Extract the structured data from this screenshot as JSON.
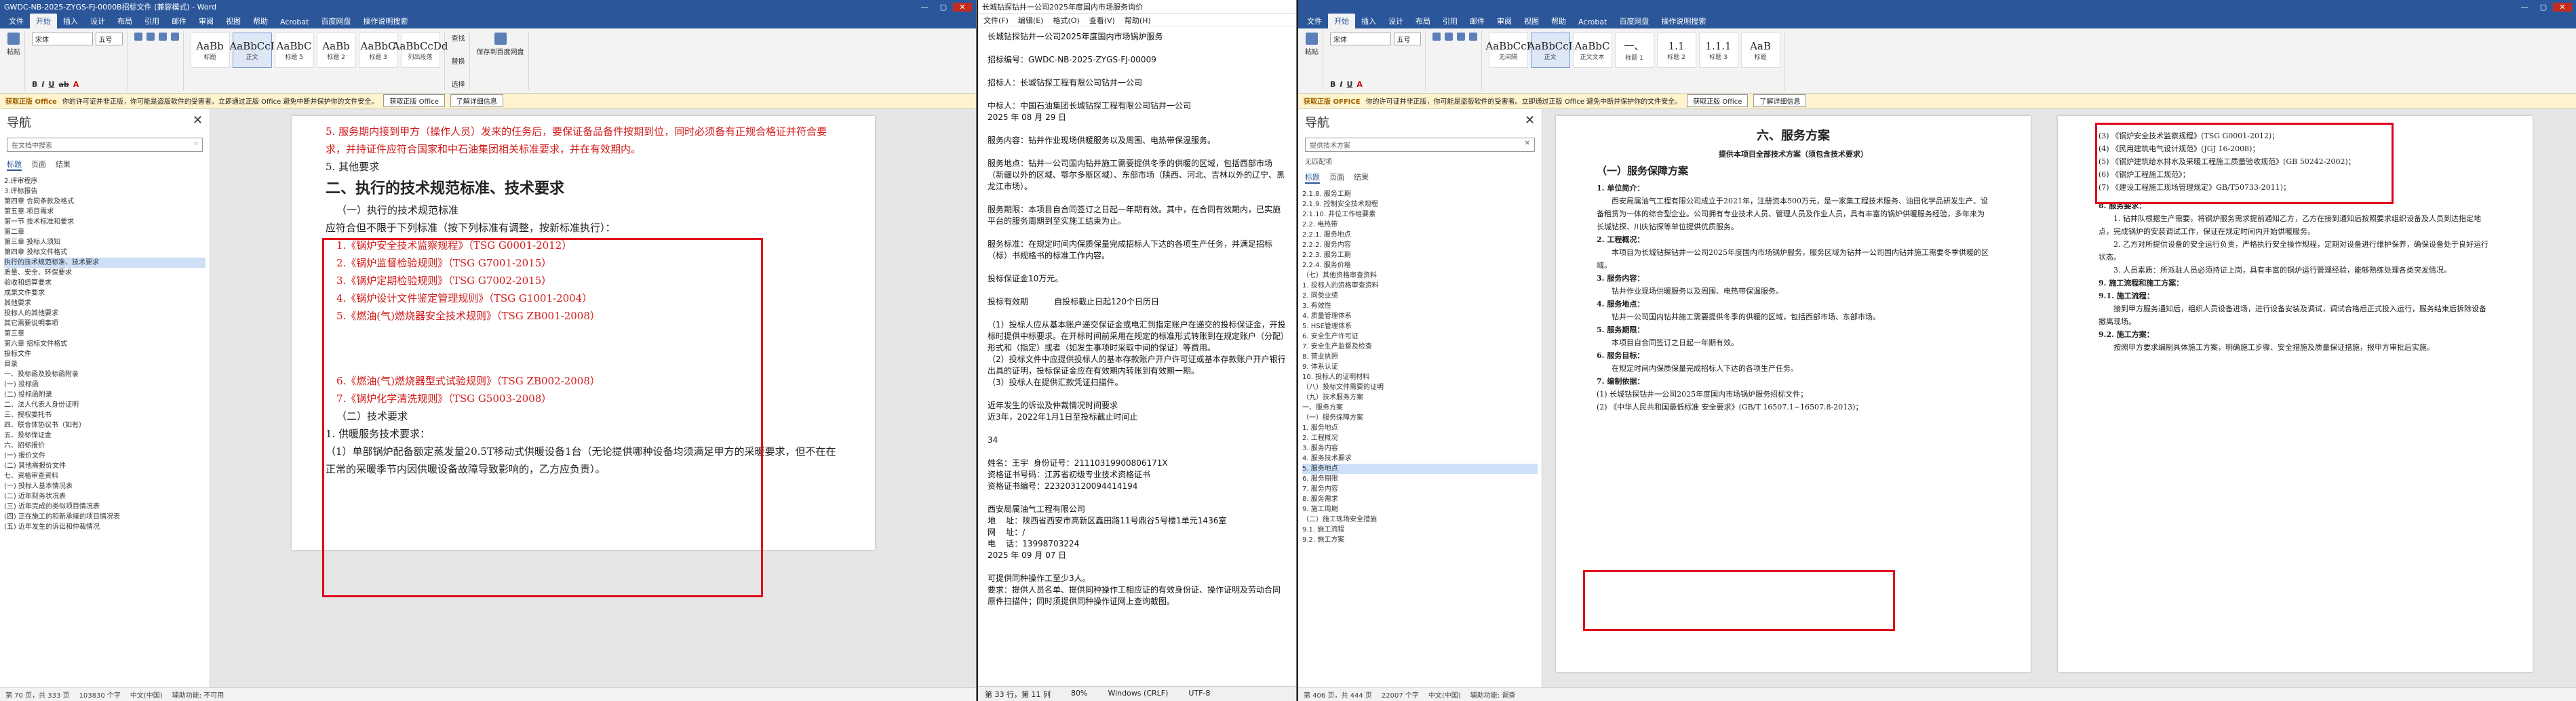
{
  "w1": {
    "title": "GWDC-NB-2025-ZYGS-FJ-0000B招标文件 (兼容模式) - Word",
    "tabs": [
      "文件",
      "开始",
      "插入",
      "设计",
      "布局",
      "引用",
      "邮件",
      "审阅",
      "视图",
      "帮助",
      "Acrobat",
      "百度网盘",
      "操作说明搜索"
    ],
    "font_name": "宋体",
    "font_size": "五号",
    "styles": [
      {
        "preview": "AaBb",
        "name": "标题"
      },
      {
        "preview": "AaBbCcI",
        "name": "正文"
      },
      {
        "preview": "AaBbC",
        "name": "标题 5"
      },
      {
        "preview": "AaBb",
        "name": "标题 2"
      },
      {
        "preview": "AaBbC",
        "name": "标题 3"
      },
      {
        "preview": "AaBbCcDd",
        "name": "列出段落"
      }
    ],
    "ribbon_right": [
      "查找",
      "替换",
      "选择",
      "保存到百度网盘"
    ],
    "infobar": {
      "warn": "获取正版 Office",
      "text": "你的许可证并非正版，你可能是盗版软件的受害者。立即通过正版 Office 避免中断并保护你的文件安全。",
      "btn1": "获取正版 Office",
      "btn2": "了解详细信息"
    },
    "nav": {
      "title": "导航",
      "search": "在文档中搜索",
      "tabs": [
        "标题",
        "页面",
        "结果"
      ],
      "items": [
        "2.评审程序",
        "3.评标报告",
        "第四章  合同条款及格式",
        "第五章  项目需求",
        "第一节  技术标准和要求",
        "第二章",
        "第三章  投标人须知",
        "第四章  投标文件格式",
        "执行的技术规范标准、技术要求",
        "质量、安全、环保要求",
        "验收和结算要求",
        "成果文件要求",
        "其他要求",
        "投标人的其他要求",
        "其它需要说明事项",
        "第三章",
        "第六章  招标文件格式",
        "投标文件",
        "目录",
        "一、投标函及投标函附录",
        "(一) 投标函",
        "(二) 投标函附录",
        "二、法人代表人身份证明",
        "三、授权委托书",
        "四、联合体协议书（如有）",
        "五、投标保证金",
        "六、招标报价",
        "(一) 报价文件",
        "(二) 其他需报价文件",
        "七、资格审查资料",
        "(一) 投标人基本情况表",
        "(二) 近年财务状况表",
        "(三) 近年完成的类似项目情况表",
        "(四) 正在施工的和新承接的项目情况表",
        "(五) 近年发生的诉讼和仲裁情况"
      ]
    },
    "doc": {
      "line0": "5. 服务期内接到甲方（操作人员）发来的任务后，要保证备品备件按期到位，同时必须备有正规合格证并符合要求，并持证件应符合国家和中石油集团相关标准要求，并在有效期内。",
      "line1": "5. 其他要求",
      "heading": "二、执行的技术规范标准、技术要求",
      "sub": "（一）执行的技术规范标准",
      "intro": "应符合但不限于下列标准（按下列标准有调整，按新标准执行）：",
      "items": [
        "1.《锅炉安全技术监察规程》（TSG G0001-2012）",
        "2.《锅炉监督检验规则》（TSG G7001-2015）",
        "3.《锅炉定期检验规则》（TSG G7002-2015）",
        "4.《锅炉设计文件鉴定管理规则》（TSG G1001-2004）",
        "5.《燃油(气)燃烧器安全技术规则》（TSG ZB001-2008）"
      ],
      "items2": [
        "6.《燃油(气)燃烧器型式试验规则》（TSG ZB002-2008）",
        "7.《锅炉化学清洗规则》（TSG G5003-2008）"
      ],
      "sub2": "（二）技术要求",
      "req1": "1. 供暖服务技术要求：",
      "req2": "（1）单部锅炉配备额定蒸发量20.5T移动式供暖设备1台（无论提供哪种设备均须满足甲方的采暖要求，但不在在正常的采暖季节内因供暖设备故障导致影响的，乙方应负责）。"
    },
    "status": [
      "第 70 页，共 333 页",
      "103830 个字",
      "中文(中国)",
      "辅助功能: 不可用"
    ]
  },
  "w2": {
    "title": "长城钻探钻井一公司2025年度国内市场服务询价",
    "menu": [
      "文件(F)",
      "编辑(E)",
      "格式(O)",
      "查看(V)",
      "帮助(H)"
    ],
    "text": "长城钻探钻井一公司2025年度国内市场锅炉服务\n\n招标编号：GWDC-NB-2025-ZYGS-FJ-00009\n\n招标人：长城钻探工程有限公司钻井一公司\n\n中标人：中国石油集团长城钻探工程有限公司钻井一公司\n2025 年 08 月 29 日\n\n服务内容：钻井作业现场供暖服务以及周围、电热带保温服务。\n\n服务地点：钻井一公司国内钻井施工需要提供冬季的供暖的区域，包括西部市场（新疆以外的区域、鄂尔多斯区域）、东部市场（陕西、河北、吉林以外的辽宁、黑龙江市场）。\n\n服务期限：本项目自合同签订之日起一年期有效。其中，在合同有效期内，已实施平台的服务周期到至实施工结束为止。\n\n服务标准：在规定时间内保质保量完成招标人下达的各项生产任务，并满足招标（标）书规格书的标准工作内容。\n\n投标保证金10万元。\n\n投标有效期          自投标截止日起120个日历日\n\n（1）投标人应从基本账户递交保证金或电汇到指定账户在递交的投标保证金，开投标时提供中标要求。在开标时间前采用在规定的标准形式转账到在规定账户（分配）形式和（指定）或者（如发生事项时采取中间的保证）等费用。\n（2）投标文件中应提供投标人的基本存款账户开户许可证或基本存款账户开户银行出具的证明，投标保证金应在有效期内转账到有效期一期。\n（3）投标人在提供汇款凭证扫描件。\n\n近年发生的诉讼及仲裁情况时间要求\n近3年，2022年1月1日至投标截止时间止\n\n34\n\n姓名：王宇  身份证号：21110319900806171X\n资格证书号码：江苏省初级专业技术资格证书\n资格证书编号：223203120094414194\n\n西安局属油气工程有限公司\n地    址：陕西省西安市高新区鑫田路11号鼎谷5号楼1单元1436室\n网    址：/\n电    话：13998703224\n2025 年 09 月 07 日\n\n可提供同种操作工至少3人。\n要求：提供人员名单、提供同种操作工相应证的有效身份证、操作证明及劳动合同原件扫描件；同时须提供同种操作证网上查询截图。",
    "status": [
      "第 33 行，第 11 列",
      "80%",
      "Windows (CRLF)",
      "UTF-8"
    ]
  },
  "w3": {
    "tabs": [
      "文件",
      "开始",
      "插入",
      "设计",
      "布局",
      "引用",
      "邮件",
      "审阅",
      "视图",
      "帮助",
      "Acrobat",
      "百度网盘",
      "操作说明搜索"
    ],
    "font_name": "宋体",
    "font_size": "五号",
    "styles": [
      {
        "preview": "AaBbCcI",
        "name": "无间隔"
      },
      {
        "preview": "AaBbCcI",
        "name": "正文"
      },
      {
        "preview": "AaBbC",
        "name": "正文文本"
      },
      {
        "preview": "一、",
        "name": "标题 1"
      },
      {
        "preview": "1.1",
        "name": "标题 2"
      },
      {
        "preview": "1.1.1",
        "name": "标题 3"
      },
      {
        "preview": "AaB",
        "name": "标题"
      }
    ],
    "infobar": {
      "warn": "获取正版 OFFICE",
      "text": "你的许可证并非正版，你可能是盗版软件的受害者。立即通过正版 Office 避免中断并保护你的文件安全。",
      "btn1": "获取正版 Office",
      "btn2": "了解详细信息"
    },
    "nav": {
      "title": "导航",
      "search": "提供技术方案",
      "result": "无匹配项",
      "tabs": [
        "标题",
        "页面",
        "结果"
      ],
      "items": [
        "2.1.8. 服务工期",
        "2.1.9. 控制安全技术规程",
        "2.1.10. 井位工作组要素",
        "2.2. 电热带",
        "2.2.1. 服务地点",
        "2.2.2. 服务内容",
        "2.2.3. 服务工期",
        "2.2.4. 服务价格",
        "（七）其他资格审查资料",
        "1. 投标人的资格审查资料",
        "2. 同类业绩",
        "3. 有效性",
        "4. 质量管理体系",
        "5. HSE管理体系",
        "6. 安全生产许可证",
        "7. 安全生产监督及检查",
        "8. 营业执照",
        "9. 体系认证",
        "10. 投标人的证明材料",
        "（八）投标文件需要的证明",
        "（九）技术服务方案",
        "一、服务方案",
        "（一）服务保障方案",
        "1. 服务地点",
        "2. 工程概况",
        "3. 服务内容",
        "4. 服务技术要求",
        "5. 服务地点",
        "6. 服务期限",
        "7. 服务内容",
        "8. 服务需求",
        "9. 施工周期",
        "（二）施工现场安全措施",
        "9.1. 施工流程",
        "9.2. 施工方案"
      ]
    },
    "doc": {
      "title": "六、服务方案",
      "sub_title": "提供本项目全部技术方案（须包含技术要求）",
      "h3": "（一）服务保障方案",
      "s1": "1. 单位简介：",
      "p1": "西安局属油气工程有限公司成立于2021年，注册资本500万元，是一家集工程技术服务、油田化学品研发生产、设备租赁为一体的综合型企业。公司拥有专业技术人员、管理人员及作业人员，具有丰富的锅炉供暖服务经验，多年来为长城钻探、川庆钻探等单位提供优质服务。",
      "s2": "2. 工程概况：",
      "p2": "本项目为长城钻探钻井一公司2025年度国内市场锅炉服务，服务区域为钻井一公司国内钻井施工需要冬季供暖的区域。",
      "s3": "3. 服务内容：",
      "p3": "钻井作业现场供暖服务以及周围、电热带保温服务。",
      "s4": "4. 服务地点：",
      "p4": "钻井一公司国内钻井施工需要提供冬季的供暖的区域，包括西部市场、东部市场。",
      "s5": "5. 服务期限：",
      "p5": "本项目自合同签订之日起一年期有效。",
      "s6": "6. 服务目标：",
      "p6": "在规定时间内保质保量完成招标人下达的各项生产任务。",
      "s7": "7. 编制依据：",
      "basis": [
        "(1) 长城钻探钻井一公司2025年度国内市场锅炉服务招标文件；",
        "(2) 《中华人民共和国最低标准 安全要求》(GB/T 16507.1~16507.8-2013)；"
      ],
      "right_items": [
        "(3) 《锅炉安全技术监察规程》(TSG G0001-2012)；",
        "(4) 《民用建筑电气设计规范》(JGJ 16-2008)；",
        "(5) 《锅炉建筑给水排水及采暖工程施工质量验收规范》(GB 50242-2002)；",
        "(6) 《锅炉工程施工规范》；",
        "(7) 《建设工程施工现场管理规定》GB/T50733-2011)；"
      ],
      "right_s8": "8. 服务要求：",
      "right_p8": "1. 钻井队根据生产需要，将锅炉服务需求提前通知乙方，乙方在接到通知后按照要求组织设备及人员到达指定地点，完成锅炉的安装调试工作，保证在规定时间内开始供暖服务。",
      "right_p9": "2. 乙方对所提供设备的安全运行负责，严格执行安全操作规程，定期对设备进行维护保养，确保设备处于良好运行状态。",
      "right_p10": "3. 人员素质：所派驻人员必须持证上岗，具有丰富的锅炉运行管理经验，能够熟练处理各类突发情况。",
      "right_s9": "9. 施工流程和施工方案：",
      "right_s91": "9.1. 施工流程：",
      "right_p11": "接到甲方服务通知后，组织人员设备进场，进行设备安装及调试，调试合格后正式投入运行，服务结束后拆除设备撤离现场。",
      "right_s92": "9.2. 施工方案：",
      "right_p12": "按照甲方要求编制具体施工方案，明确施工步骤、安全措施及质量保证措施，报甲方审批后实施。"
    },
    "status": [
      "第 406 页，共 444 页",
      "22007 个字",
      "中文(中国)",
      "辅助功能: 调查"
    ]
  }
}
